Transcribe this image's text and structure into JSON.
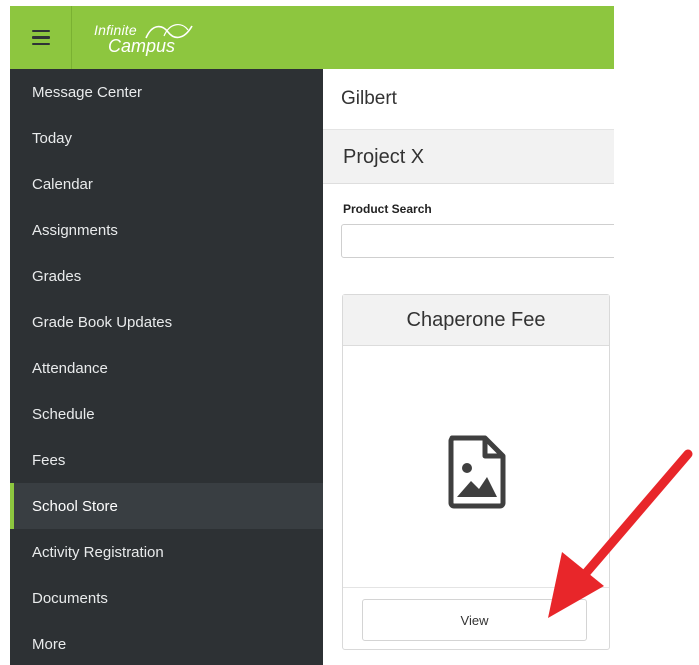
{
  "header": {
    "logo_line1": "Infinite",
    "logo_line2": "Campus",
    "accent_color": "#8dc63f"
  },
  "sidebar": {
    "items": [
      {
        "label": "Message Center",
        "active": false
      },
      {
        "label": "Today",
        "active": false
      },
      {
        "label": "Calendar",
        "active": false
      },
      {
        "label": "Assignments",
        "active": false
      },
      {
        "label": "Grades",
        "active": false
      },
      {
        "label": "Grade Book Updates",
        "active": false
      },
      {
        "label": "Attendance",
        "active": false
      },
      {
        "label": "Schedule",
        "active": false
      },
      {
        "label": "Fees",
        "active": false
      },
      {
        "label": "School Store",
        "active": true
      },
      {
        "label": "Activity Registration",
        "active": false
      },
      {
        "label": "Documents",
        "active": false
      },
      {
        "label": "More",
        "active": false
      }
    ]
  },
  "main": {
    "student_name": "Gilbert",
    "project_title": "Project X",
    "search": {
      "label": "Product Search",
      "value": "",
      "placeholder": ""
    },
    "product_card": {
      "title": "Chaperone Fee",
      "image_icon": "image-placeholder-icon",
      "view_label": "View"
    }
  },
  "annotation": {
    "arrow_color": "#e8262a"
  }
}
